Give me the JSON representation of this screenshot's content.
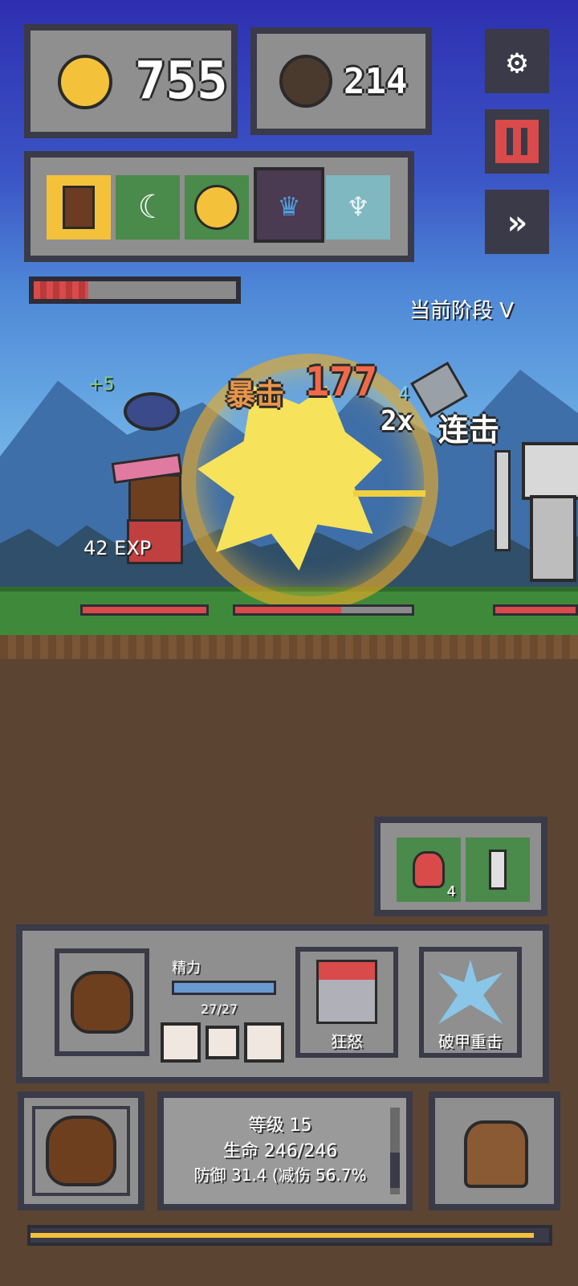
{
  "resources": {
    "gold": "755",
    "gems": "214"
  },
  "effects_bar": {
    "slots": [
      "book-icon",
      "sickle-icon",
      "coin-icon",
      "crown-icon",
      "wings-icon"
    ]
  },
  "stage": {
    "label": "当前阶段 V"
  },
  "battle": {
    "crit_label": "暴击",
    "crit_value": "177",
    "combo_multiplier": "2x",
    "combo_label": "连击",
    "combo_small": "4",
    "plus_text": "+5",
    "exp_text": "42 EXP"
  },
  "consumables": {
    "items": [
      "health-potion-icon",
      "scroll-icon"
    ],
    "potion_count": "4"
  },
  "hero_panel": {
    "stamina_label": "精力",
    "stamina_value": "27/27",
    "stamina_fraction": 1.0,
    "skills": [
      {
        "name": "狂怒",
        "icon": "spartan-helmet-icon"
      },
      {
        "name": "破甲重击",
        "icon": "ice-shatter-icon"
      }
    ]
  },
  "stats": {
    "level": "等级 15",
    "hp": "生命 246/246",
    "defense": "防御 31.4 (减伤 56.7%"
  },
  "progress": {
    "wave_fraction": 0.27,
    "bottom_fraction": 0.97
  },
  "colors": {
    "accent_gold": "#f4c23a",
    "hp_red": "#d94a4a",
    "panel_border": "#3a3a48"
  }
}
